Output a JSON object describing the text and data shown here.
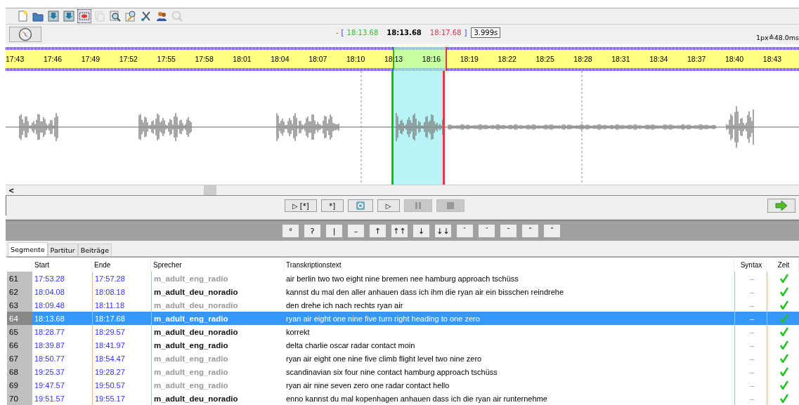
{
  "toolbar": {
    "tools": [
      {
        "kind": "new",
        "pressed": false,
        "disabled": false
      },
      {
        "kind": "open",
        "pressed": false,
        "disabled": false
      },
      {
        "kind": "save",
        "pressed": false,
        "disabled": false
      },
      {
        "kind": "saveas",
        "pressed": false,
        "disabled": false
      },
      {
        "kind": "select",
        "pressed": true,
        "disabled": false
      },
      {
        "kind": "copy",
        "pressed": false,
        "disabled": true
      },
      {
        "kind": "zoom",
        "pressed": false,
        "disabled": false
      },
      {
        "kind": "edit",
        "pressed": false,
        "disabled": false
      },
      {
        "kind": "cut",
        "pressed": false,
        "disabled": false
      },
      {
        "kind": "users",
        "pressed": false,
        "disabled": false
      },
      {
        "kind": "fit",
        "pressed": false,
        "disabled": true
      }
    ]
  },
  "selection": {
    "dash": "-",
    "open": "[",
    "start": "18:13.68",
    "cursor": "18:13.68",
    "end": "18:17.68",
    "close": "]",
    "length": "3.999s",
    "scale": "1px≙48.0ms"
  },
  "timeline": {
    "labels": [
      "17:43",
      "17:46",
      "17:49",
      "17:52",
      "17:55",
      "17:58",
      "18:01",
      "18:04",
      "18:07",
      "18:10",
      "18:13",
      "18:16",
      "18:19",
      "18:22",
      "18:25",
      "18:28",
      "18:31",
      "18:34",
      "18:37",
      "18:40",
      "18:43"
    ]
  },
  "scrollbar": {
    "arrow": "<"
  },
  "player": {
    "buttons": [
      {
        "kind": "text",
        "label": "▷ [*]",
        "disabled": false
      },
      {
        "kind": "text",
        "label": "*]",
        "disabled": false
      },
      {
        "kind": "loop",
        "disabled": false
      },
      {
        "kind": "text",
        "label": "▷",
        "disabled": false
      },
      {
        "kind": "pause",
        "disabled": true
      },
      {
        "kind": "stop",
        "disabled": true
      }
    ]
  },
  "symbols": [
    "°",
    "ʔ",
    "|",
    "–",
    "↑",
    "↑↑",
    "↓",
    "↓↓",
    "`",
    "´",
    "¯",
    "ˆ",
    "ˇ"
  ],
  "tabs": [
    {
      "label": "Segmente",
      "selected": true
    },
    {
      "label": "Partitur",
      "selected": false
    },
    {
      "label": "Beiträge",
      "selected": false
    }
  ],
  "table": {
    "columns": [
      "Start",
      "Ende",
      "Sprecher",
      "Transkriptionstext",
      "Syntax",
      "Zeit"
    ],
    "rows": [
      {
        "number": "61",
        "start": "17:53.28",
        "end": "17:57.28",
        "speaker": "m_adult_eng_radio",
        "dimmed": true,
        "text": "air berlin two two eight nine bremen nee hamburg approach tschüss",
        "syntax": "–",
        "time_ok": true,
        "selected": false
      },
      {
        "number": "62",
        "start": "18:04.08",
        "end": "18:08.18",
        "speaker": "m_adult_deu_noradio",
        "dimmed": false,
        "text": "kannst du mal den aller anhauen dass ich ihm die ryan air ein bisschen reindrehe",
        "syntax": "–",
        "time_ok": true,
        "selected": false
      },
      {
        "number": "63",
        "start": "18:09.48",
        "end": "18:11.18",
        "speaker": "m_adult_deu_noradio",
        "dimmed": true,
        "text": "den drehe ich nach rechts ryan air",
        "syntax": "–",
        "time_ok": true,
        "selected": false
      },
      {
        "number": "64",
        "start": "18:13.68",
        "end": "18:17.68",
        "speaker": "m_adult_eng_radio",
        "dimmed": false,
        "text": "ryan air eight one nine five turn right heading to one zero",
        "syntax": "–",
        "time_ok": true,
        "selected": true
      },
      {
        "number": "65",
        "start": "18:28.77",
        "end": "18:29.57",
        "speaker": "m_adult_deu_noradio",
        "dimmed": false,
        "text": "korrekt",
        "syntax": "–",
        "time_ok": true,
        "selected": false
      },
      {
        "number": "66",
        "start": "18:39.87",
        "end": "18:41.97",
        "speaker": "m_adult_eng_radio",
        "dimmed": false,
        "text": "delta charlie oscar radar contact moin",
        "syntax": "–",
        "time_ok": true,
        "selected": false
      },
      {
        "number": "67",
        "start": "18:50.77",
        "end": "18:54.47",
        "speaker": "m_adult_eng_radio",
        "dimmed": true,
        "text": "ryan air eight one nine five climb flight level two nine zero",
        "syntax": "–",
        "time_ok": true,
        "selected": false
      },
      {
        "number": "68",
        "start": "19:25.37",
        "end": "19:28.27",
        "speaker": "m_adult_eng_radio",
        "dimmed": true,
        "text": "scandinavian six four nine contact hamburg approach tschüss",
        "syntax": "–",
        "time_ok": true,
        "selected": false
      },
      {
        "number": "69",
        "start": "19:47.57",
        "end": "19:50.57",
        "speaker": "m_adult_eng_radio",
        "dimmed": true,
        "text": "ryan air nine seven zero one radar contact hello",
        "syntax": "–",
        "time_ok": true,
        "selected": false
      },
      {
        "number": "70",
        "start": "19:51.57",
        "end": "19:55.17",
        "speaker": "m_adult_deu_noradio",
        "dimmed": false,
        "text": "enno kannst du mal kopenhagen anhauen dass ich die ryan air runternehme",
        "syntax": "–",
        "time_ok": true,
        "selected": false
      }
    ]
  }
}
